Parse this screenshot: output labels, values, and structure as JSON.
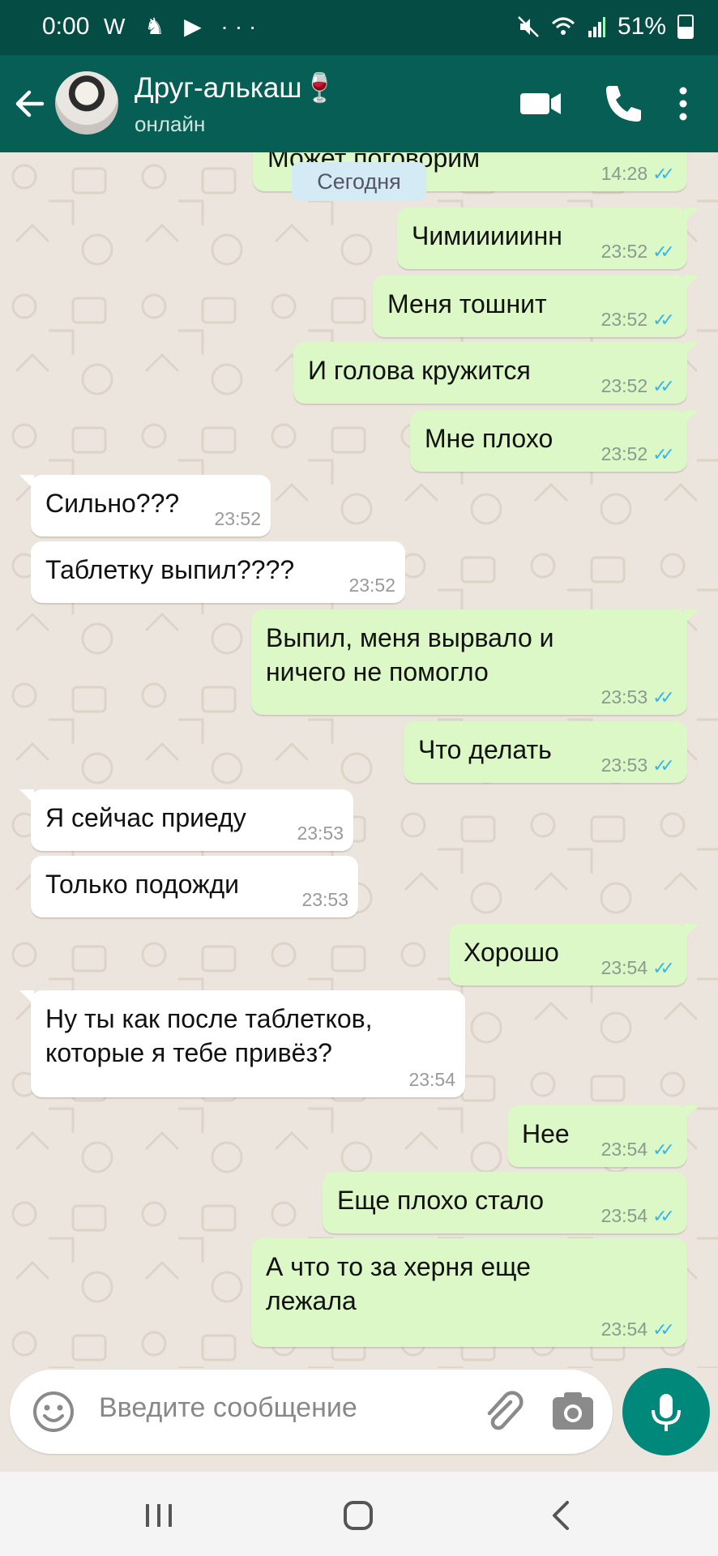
{
  "status_bar": {
    "time": "0:00",
    "left_icons": "W ♞ ▶ ···",
    "battery": "51%"
  },
  "header": {
    "title": "Друг-алькаш🍷",
    "subtitle": "онлайн"
  },
  "chat": {
    "date_chip": "Сегодня",
    "messages": [
      {
        "dir": "out",
        "text": "Может поговорим",
        "time": "14:28"
      },
      {
        "dir": "out",
        "text": "Чимииииинн",
        "time": "23:52"
      },
      {
        "dir": "out",
        "text": "Меня тошнит",
        "time": "23:52"
      },
      {
        "dir": "out",
        "text": "И голова кружится",
        "time": "23:52"
      },
      {
        "dir": "out",
        "text": "Мне плохо",
        "time": "23:52"
      },
      {
        "dir": "in",
        "text": "Сильно???",
        "time": "23:52"
      },
      {
        "dir": "in",
        "text": "Таблетку выпил????",
        "time": "23:52"
      },
      {
        "dir": "out",
        "text": "Выпил, меня вырвало и\nничего не помогло",
        "time": "23:53"
      },
      {
        "dir": "out",
        "text": "Что делать",
        "time": "23:53"
      },
      {
        "dir": "in",
        "text": "Я сейчас приеду",
        "time": "23:53"
      },
      {
        "dir": "in",
        "text": "Только подожди",
        "time": "23:53"
      },
      {
        "dir": "out",
        "text": "Хорошо",
        "time": "23:54"
      },
      {
        "dir": "in",
        "text": "Ну ты как после таблетков,\nкоторые я тебе  привёз?",
        "time": "23:54"
      },
      {
        "dir": "out",
        "text": "Нее",
        "time": "23:54"
      },
      {
        "dir": "out",
        "text": "Еще плохо стало",
        "time": "23:54"
      },
      {
        "dir": "out",
        "text": "А что то за херня еще\nлежала",
        "time": "23:54"
      }
    ]
  },
  "input": {
    "placeholder": "Введите сообщение"
  },
  "colors": {
    "header": "#075e54",
    "status_bar": "#054d44",
    "outgoing_bubble": "#dcf8c6",
    "incoming_bubble": "#ffffff",
    "read_ticks": "#34b7f1",
    "mic_button": "#00897b"
  },
  "icons": [
    "back-arrow-icon",
    "video-call-icon",
    "phone-icon",
    "more-vert-icon",
    "emoji-icon",
    "attach-icon",
    "camera-icon",
    "mic-icon",
    "recents-icon",
    "home-icon",
    "back-nav-icon"
  ]
}
